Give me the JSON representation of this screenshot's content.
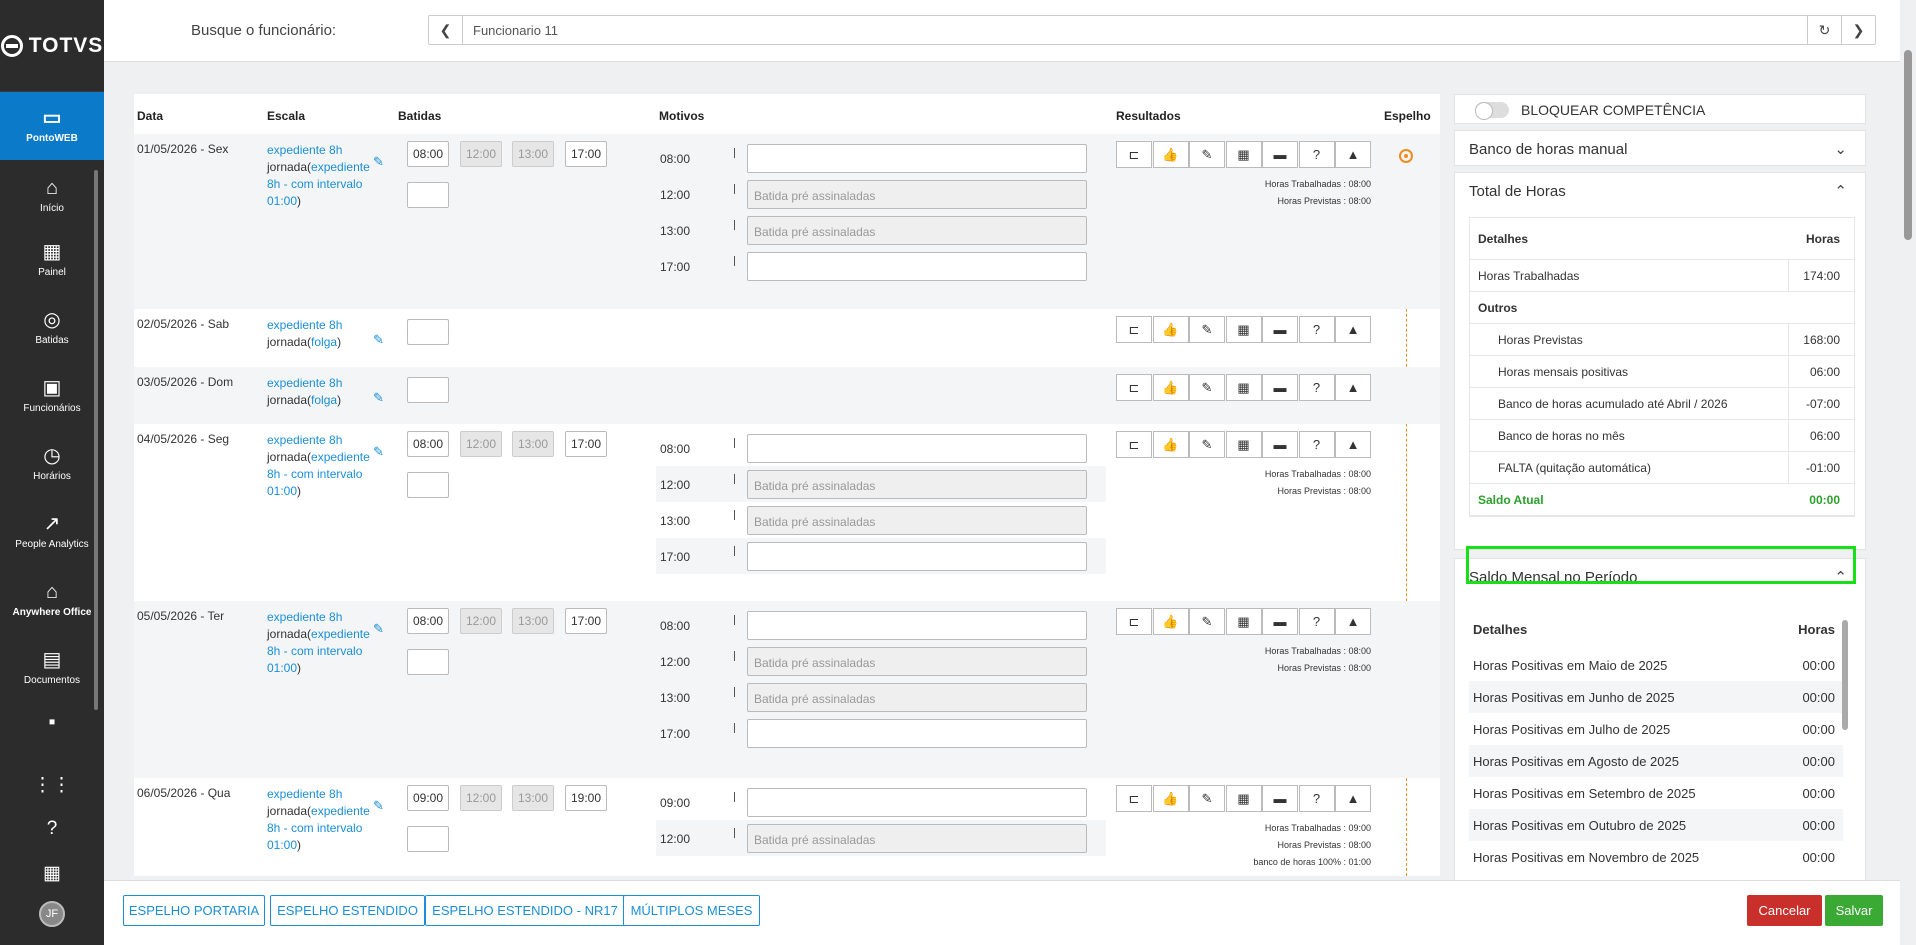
{
  "sidebar": {
    "logo": "TOTVS",
    "items": [
      {
        "label": "PontoWEB",
        "icon": "monitor-icon"
      },
      {
        "label": "Início",
        "icon": "home-icon"
      },
      {
        "label": "Painel",
        "icon": "dashboard-icon"
      },
      {
        "label": "Batidas",
        "icon": "fingerprint-icon"
      },
      {
        "label": "Funcionários",
        "icon": "badge-icon"
      },
      {
        "label": "Horários",
        "icon": "clock-icon"
      },
      {
        "label": "People Analytics",
        "icon": "trending-up-icon"
      },
      {
        "label": "Anywhere Office",
        "icon": "house-icon"
      },
      {
        "label": "Documentos",
        "icon": "document-icon"
      }
    ],
    "avatar": "JF"
  },
  "header": {
    "search_label": "Busque o funcionário:",
    "employee": "Funcionario 11"
  },
  "columns": {
    "data": "Data",
    "escala": "Escala",
    "batidas": "Batidas",
    "motivos": "Motivos",
    "resultados": "Resultados",
    "espelho": "Espelho"
  },
  "days": [
    {
      "date": "01/05/2026 - Sex",
      "esc1": "expediente 8h",
      "esc2": "jornada(",
      "esc3": "expediente 8h - com intervalo 01:00",
      "esc4": ")",
      "b": [
        "08:00",
        "12:00",
        "13:00",
        "17:00"
      ],
      "motivos": [
        {
          "t": "08:00",
          "ph": ""
        },
        {
          "t": "12:00",
          "ph": "Batida pré assinaladas"
        },
        {
          "t": "13:00",
          "ph": "Batida pré assinaladas"
        },
        {
          "t": "17:00",
          "ph": ""
        }
      ],
      "res": [
        "Horas Trabalhadas : 08:00",
        "Horas Previstas : 08:00"
      ]
    },
    {
      "date": "02/05/2026 - Sab",
      "esc1": "expediente 8h",
      "esc2": "jornada(",
      "esc3": "folga",
      "esc4": ")"
    },
    {
      "date": "03/05/2026 - Dom",
      "esc1": "expediente 8h",
      "esc2": "jornada(",
      "esc3": "folga",
      "esc4": ")"
    },
    {
      "date": "04/05/2026 - Seg",
      "esc1": "expediente 8h",
      "esc2": "jornada(",
      "esc3": "expediente 8h - com intervalo 01:00",
      "esc4": ")",
      "b": [
        "08:00",
        "12:00",
        "13:00",
        "17:00"
      ],
      "motivos": [
        {
          "t": "08:00",
          "ph": ""
        },
        {
          "t": "12:00",
          "ph": "Batida pré assinaladas"
        },
        {
          "t": "13:00",
          "ph": "Batida pré assinaladas"
        },
        {
          "t": "17:00",
          "ph": ""
        }
      ],
      "res": [
        "Horas Trabalhadas : 08:00",
        "Horas Previstas : 08:00"
      ]
    },
    {
      "date": "05/05/2026 - Ter",
      "esc1": "expediente 8h",
      "esc2": "jornada(",
      "esc3": "expediente 8h - com intervalo 01:00",
      "esc4": ")",
      "b": [
        "08:00",
        "12:00",
        "13:00",
        "17:00"
      ],
      "motivos": [
        {
          "t": "08:00",
          "ph": ""
        },
        {
          "t": "12:00",
          "ph": "Batida pré assinaladas"
        },
        {
          "t": "13:00",
          "ph": "Batida pré assinaladas"
        },
        {
          "t": "17:00",
          "ph": ""
        }
      ],
      "res": [
        "Horas Trabalhadas : 08:00",
        "Horas Previstas : 08:00"
      ]
    },
    {
      "date": "06/05/2026 - Qua",
      "esc1": "expediente 8h",
      "esc2": "jornada(",
      "esc3": "expediente 8h - com intervalo 01:00",
      "esc4": ")",
      "b": [
        "09:00",
        "12:00",
        "13:00",
        "19:00"
      ],
      "motivos": [
        {
          "t": "09:00",
          "ph": ""
        },
        {
          "t": "12:00",
          "ph": "Batida pré assinaladas"
        }
      ],
      "res": [
        "Horas Trabalhadas : 09:00",
        "Horas Previstas : 08:00",
        "banco de horas 100% : 01:00"
      ]
    }
  ],
  "right": {
    "bloquear": "BLOQUEAR COMPETÊNCIA",
    "banco_manual": "Banco de horas manual",
    "total_horas": "Total de Horas",
    "th_detalhes": "Detalhes",
    "th_horas": "Horas",
    "rows": [
      {
        "n": "Horas Trabalhadas",
        "v": "174:00"
      },
      {
        "n": "Outros",
        "v": ""
      },
      {
        "n": "Horas Previstas",
        "v": "168:00"
      },
      {
        "n": "Horas mensais positivas",
        "v": "06:00"
      },
      {
        "n": "Banco de horas acumulado até Abril / 2026",
        "v": "-07:00"
      },
      {
        "n": "Banco de horas no mês",
        "v": "06:00"
      },
      {
        "n": "FALTA (quitação automática)",
        "v": "-01:00"
      },
      {
        "n": "Saldo Atual",
        "v": "00:00"
      }
    ],
    "saldo_mensal": "Saldo Mensal no Período",
    "sm_detalhes": "Detalhes",
    "sm_horas": "Horas",
    "months": [
      {
        "n": "Horas Positivas em Maio de 2025",
        "v": "00:00"
      },
      {
        "n": "Horas Positivas em Junho de 2025",
        "v": "00:00"
      },
      {
        "n": "Horas Positivas em Julho de 2025",
        "v": "00:00"
      },
      {
        "n": "Horas Positivas em Agosto de 2025",
        "v": "00:00"
      },
      {
        "n": "Horas Positivas em Setembro de 2025",
        "v": "00:00"
      },
      {
        "n": "Horas Positivas em Outubro de 2025",
        "v": "00:00"
      },
      {
        "n": "Horas Positivas em Novembro de 2025",
        "v": "00:00"
      }
    ]
  },
  "footer": {
    "b1": "ESPELHO PORTARIA",
    "b2": "ESPELHO ESTENDIDO",
    "b3": "ESPELHO ESTENDIDO - NR17",
    "b4": "MÚLTIPLOS MESES",
    "cancel": "Cancelar",
    "save": "Salvar"
  },
  "colors": {
    "accent": "#0b7ac8",
    "link": "#1a8fd6",
    "danger": "#c9302c",
    "success": "#3aaa35",
    "mirror": "#f28c1e",
    "highlight": "#18e018"
  }
}
